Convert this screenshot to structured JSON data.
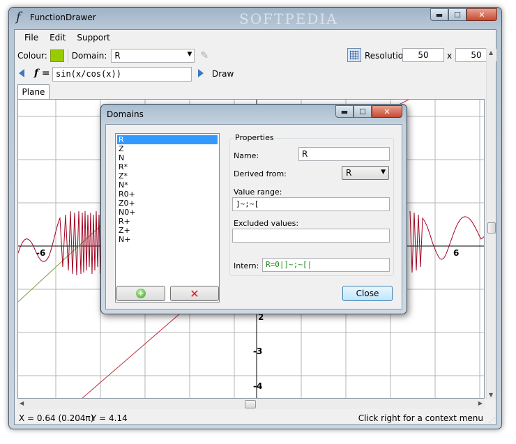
{
  "window": {
    "app_icon": "f",
    "title": "FunctionDrawer",
    "watermark": "SOFTPEDIA",
    "caption": {
      "minimize": "▬",
      "maximize": "☐",
      "close": "✕"
    }
  },
  "menu": {
    "items": [
      "File",
      "Edit",
      "Support"
    ]
  },
  "toolbar": {
    "colour_label": "Colour:",
    "colour_value": "#99cc00",
    "domain_label": "Domain:",
    "domain_value": "R",
    "resolution_label": "Resolution:",
    "resolution_x": "50",
    "resolution_sep": "x",
    "resolution_y": "50"
  },
  "function_bar": {
    "f_label": "f =",
    "expression": "sin(x/cos(x))",
    "draw_label": "Draw"
  },
  "tabs": [
    {
      "label": "Plane"
    }
  ],
  "plot": {
    "x_tick_labels": [
      "-6",
      "6"
    ],
    "y_tick_labels": [
      "-3",
      "-4",
      "2"
    ],
    "function_color": "#a00020",
    "secondary_color": "#c03040",
    "tertiary_color": "#7a9a40"
  },
  "status": {
    "x_readout": "X = 0.64 (0.204π)",
    "y_readout": "Y = 4.14",
    "hint": "Click right for a context menu"
  },
  "dialog": {
    "title": "Domains",
    "domains": [
      "R",
      "Z",
      "N",
      "R*",
      "Z*",
      "N*",
      "R0+",
      "Z0+",
      "N0+",
      "R+",
      "Z+",
      "N+"
    ],
    "selected_index": 0,
    "properties_label": "Properties",
    "name_label": "Name:",
    "name_value": "R",
    "derived_label": "Derived from:",
    "derived_value": "R",
    "range_label": "Value range:",
    "range_value": "]~;~[",
    "excluded_label": "Excluded values:",
    "excluded_value": "",
    "intern_label": "Intern:",
    "intern_value": "R=0|]~;~[|",
    "add_icon": "+",
    "delete_icon": "✕",
    "close_label": "Close"
  }
}
